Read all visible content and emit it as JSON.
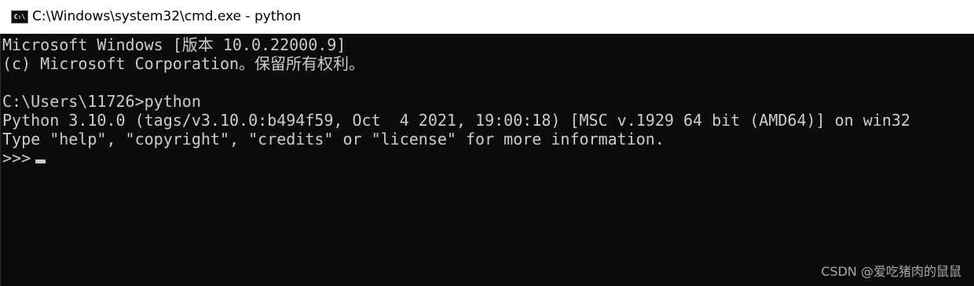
{
  "window": {
    "icon": "cmd-icon",
    "icon_label": "C:\\",
    "title": "C:\\Windows\\system32\\cmd.exe - python"
  },
  "console": {
    "lines": [
      "Microsoft Windows [版本 10.0.22000.9]",
      "(c) Microsoft Corporation。保留所有权利。",
      "",
      "C:\\Users\\11726>python",
      "Python 3.10.0 (tags/v3.10.0:b494f59, Oct  4 2021, 19:00:18) [MSC v.1929 64 bit (AMD64)] on win32",
      "Type \"help\", \"copyright\", \"credits\" or \"license\" for more information.",
      ">>>"
    ]
  },
  "watermark": "CSDN @爱吃猪肉的鼠鼠",
  "colors": {
    "console_bg": "#0c0c0c",
    "console_fg": "#cccccc",
    "titlebar_bg": "#ffffff"
  }
}
